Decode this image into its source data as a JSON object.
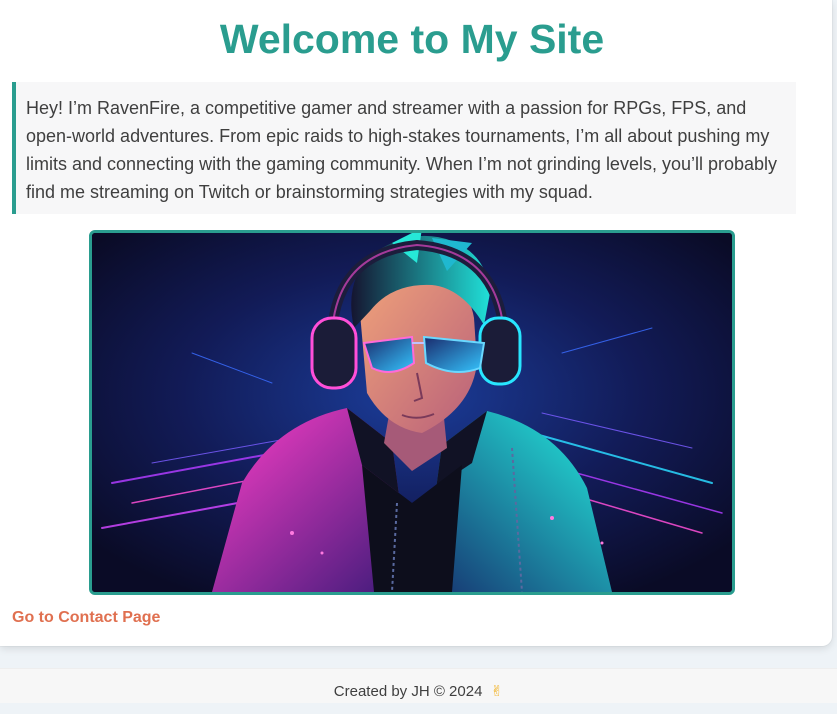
{
  "header": {
    "title": "Welcome to My Site"
  },
  "bio": {
    "text": "Hey! I’m RavenFire, a competitive gamer and streamer with a passion for RPGs, FPS, and open-world adventures. From epic raids to high-stakes tournaments, I’m all about pushing my limits and connecting with the gaming community. When I’m not grinding levels, you’ll probably find me streaming on Twitch or brainstorming strategies with my squad."
  },
  "hero": {
    "icon": "gamer-avatar-illustration"
  },
  "nav": {
    "contact_label": "Go to Contact Page"
  },
  "footer": {
    "text": "Created by JH © 2024",
    "emoji": "✌",
    "emoji_icon": "peace-hand-icon"
  },
  "colors": {
    "accent": "#2a9d8f",
    "link": "#e07050",
    "bio_background": "#f7f7f8",
    "page_background": "#eef3f7"
  }
}
